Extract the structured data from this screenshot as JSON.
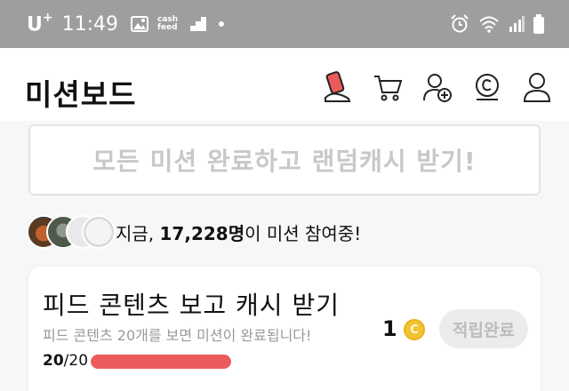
{
  "status_bar": {
    "carrier": "U",
    "carrier_sup": "+",
    "time": "11:49",
    "cashfeed_line1": "cash",
    "cashfeed_line2": "feed"
  },
  "header": {
    "title": "미션보드",
    "icons": [
      "card-icon",
      "cart-icon",
      "add-friend-icon",
      "coin-c-icon",
      "profile-icon"
    ]
  },
  "banner": {
    "text": "모든 미션 완료하고 랜덤캐시 받기!"
  },
  "participants": {
    "prefix": "지금, ",
    "count": "17,228명",
    "suffix": "이 미션 참여중!"
  },
  "mission": {
    "title": "피드 콘텐츠 보고 캐시 받기",
    "description": "피드 콘텐츠 20개를 보면 미션이 완료됩니다!",
    "progress_current": "20",
    "progress_total": "/20",
    "progress_fraction": 1.0,
    "reward": "1",
    "coin_symbol": "C",
    "button_label": "적립완료"
  },
  "colors": {
    "status_bar": "#9e9e9e",
    "progress": "#ec5b5b",
    "coin": "#f1c232",
    "card_icon_accent": "#ec5b5b"
  }
}
